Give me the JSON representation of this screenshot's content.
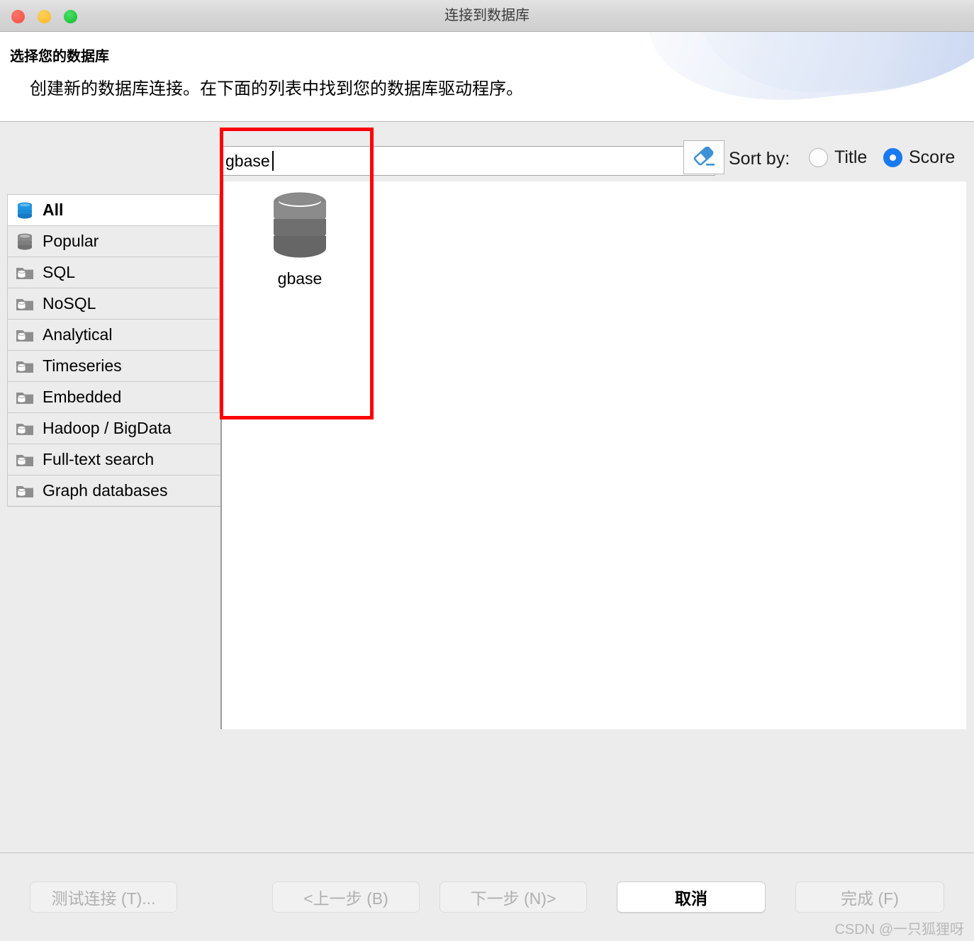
{
  "window": {
    "title": "连接到数据库",
    "traffic_lights": [
      "close-button",
      "minimize-button",
      "maximize-button"
    ],
    "colors": {
      "close": "#f6594c",
      "minimize": "#ffbe2e",
      "maximize": "#22c53e",
      "accent": "#1a7aef",
      "highlight_box": "#fe0000"
    }
  },
  "header": {
    "title": "选择您的数据库",
    "description": "创建新的数据库连接。在下面的列表中找到您的数据库驱动程序。"
  },
  "search": {
    "value": "gbase",
    "placeholder": "",
    "clear_icon": "eraser-icon"
  },
  "sort": {
    "label": "Sort by:",
    "options": [
      {
        "label": "Title",
        "selected": false
      },
      {
        "label": "Score",
        "selected": true
      }
    ]
  },
  "sidebar": {
    "items": [
      {
        "label": "All",
        "icon": "database-blue-icon",
        "selected": true,
        "wide": false
      },
      {
        "label": "Popular",
        "icon": "database-gray-icon",
        "selected": false,
        "wide": false
      },
      {
        "label": "SQL",
        "icon": "folder-database-icon",
        "selected": false,
        "wide": false
      },
      {
        "label": "NoSQL",
        "icon": "folder-database-icon",
        "selected": false,
        "wide": false
      },
      {
        "label": "Analytical",
        "icon": "folder-database-icon",
        "selected": false,
        "wide": false
      },
      {
        "label": "Timeseries",
        "icon": "folder-database-icon",
        "selected": false,
        "wide": false
      },
      {
        "label": "Embedded",
        "icon": "folder-database-icon",
        "selected": false,
        "wide": false
      },
      {
        "label": "Hadoop / BigData",
        "icon": "folder-database-icon",
        "selected": false,
        "wide": true
      },
      {
        "label": "Full-text search",
        "icon": "folder-database-icon",
        "selected": false,
        "wide": true
      },
      {
        "label": "Graph databases",
        "icon": "folder-database-icon",
        "selected": false,
        "wide": true
      }
    ]
  },
  "results": {
    "items": [
      {
        "label": "gbase",
        "icon": "database-gray-icon"
      }
    ]
  },
  "footer": {
    "buttons": [
      {
        "label": "测试连接 (T)...",
        "enabled": false
      },
      {
        "label": "<上一步 (B)",
        "enabled": false
      },
      {
        "label": "下一步 (N)>",
        "enabled": false
      },
      {
        "label": "取消",
        "enabled": true
      },
      {
        "label": "完成 (F)",
        "enabled": false
      }
    ]
  },
  "watermark": "CSDN @一只狐狸呀"
}
